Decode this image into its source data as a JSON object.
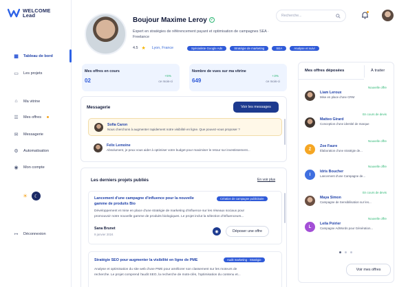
{
  "brand": {
    "line1": "WELCOME",
    "line2": "Lead"
  },
  "nav": {
    "items": [
      {
        "label": "Tableau de bord",
        "icon": "grid-icon"
      },
      {
        "label": "Les projets",
        "icon": "folder-icon"
      },
      {
        "label": "Ma vitrine",
        "icon": "store-icon"
      },
      {
        "label": "Mes offres",
        "icon": "list-icon"
      },
      {
        "label": "Messagerie",
        "icon": "chat-icon"
      },
      {
        "label": "Automatisation",
        "icon": "gear-icon"
      },
      {
        "label": "Mon compte",
        "icon": "user-icon"
      }
    ],
    "logout": "Déconnexion"
  },
  "profile": {
    "name": "Boujour Maxime Leroy",
    "bio": "Expert en stratégies de référencement payant et optimisation de campagnes SEA · Freelance",
    "rating": "4.5",
    "location": "Lyon, France",
    "skills": [
      "Spécialiste Google Ads",
      "Stratégie de marketing",
      "SEA",
      "Analyse et suivi"
    ]
  },
  "search": {
    "placeholder": "Recherche..."
  },
  "stats": [
    {
      "label": "Mes offres en cours",
      "value": "02",
      "delta": "+5%",
      "sub": "ce mois-ci"
    },
    {
      "label": "Nombre de vues sur ma vitrine",
      "value": "649",
      "delta": "+3%",
      "sub": "ce mois-ci"
    }
  ],
  "messagerie": {
    "title": "Messagerie",
    "button": "Voir les messages",
    "messages": [
      {
        "name": "Sofia Caron",
        "text": "Nous cherchons à augmenter rapidement notre visibilité en ligne. Que pouvez-vous proposer ?"
      },
      {
        "name": "Felix Lemoine",
        "text": "Absolument, je peux vous aider à optimiser votre budget pour maximiser le retour sur investissement..."
      }
    ]
  },
  "projects": {
    "title": "Les derniers projets publiés",
    "see_more": "En voir plus",
    "items": [
      {
        "title_line1": "Lancement d'une campagne d'influence pour la nouvelle",
        "title_line2": "gamme de produits Bio",
        "tag": "Création de campagne publicitaire",
        "desc_line1": "Développement et mise en place d'une stratégie de marketing d'influence sur les réseaux sociaux pour",
        "desc_line2": "promouvoir notre nouvelle gamme de produits biologiques. Le projet inclut la sélection d'influenceurs...",
        "author": "Sana Brunet",
        "date": "9 janvier 2024",
        "action": "Déposer une offre"
      },
      {
        "title_line1": "Stratégie SEO pour augmenter la visibilité en ligne de PME",
        "tag": "Audit marketing · Stratégie",
        "desc_line1": "Analyse et optimisation du site web d'une PME pour améliorer son classement sur les moteurs de",
        "desc_line2": "recherche. Le projet comprend l'audit SEO, la recherche de mots-clés, l'optimisation du contenu et..."
      }
    ]
  },
  "offers_panel": {
    "tab_active": "Mes offres déposées",
    "tab_other": "À traiter",
    "offers": [
      {
        "name": "Liam Leroux",
        "desc": "Mise en place d'une CRM",
        "status": "Nouvelle offre",
        "initial": "",
        "color": "#8a6a52"
      },
      {
        "name": "Matteo Girard",
        "desc": "Conception d'une identité de marque",
        "status": "En cours de devis",
        "initial": "",
        "color": "#6b5a4c"
      },
      {
        "name": "Zoe Faure",
        "desc": "Élaboration d'une stratégie de...",
        "status": "Nouvelle offre",
        "initial": "Z",
        "color": "#f5a623"
      },
      {
        "name": "Idris Boucher",
        "desc": "Lancement d'une Campagne de...",
        "status": "Nouvelle offre",
        "initial": "I",
        "color": "#3f6fe0"
      },
      {
        "name": "Maya Simon",
        "desc": "Campagne de Sensibilisation sur les...",
        "status": "En cours de devis",
        "initial": "",
        "color": "#9c7b6b"
      },
      {
        "name": "Leila Poirier",
        "desc": "Campagne AdWords pour Génération...",
        "status": "Nouvelle offre",
        "initial": "L",
        "color": "#a34fd6"
      }
    ],
    "button": "Voir mes offres"
  },
  "colors": {
    "primary": "#2f5ad8",
    "dark": "#1d3a8f",
    "success": "#2bb673",
    "accent": "#f5a623"
  }
}
